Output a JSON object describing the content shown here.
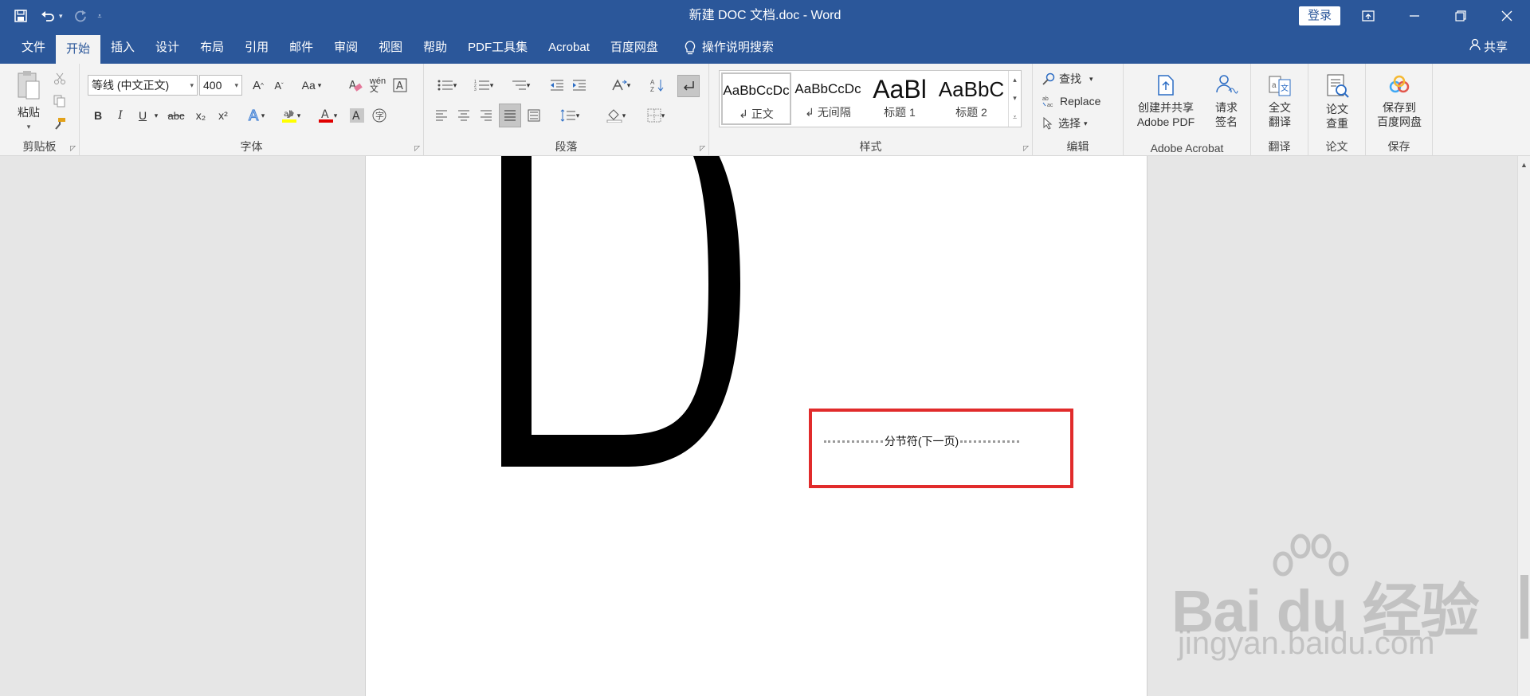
{
  "titlebar": {
    "doc_title": "新建 DOC 文档.doc  -  Word",
    "login_label": "登录",
    "icons": [
      "save-icon",
      "undo-icon",
      "redo-icon",
      "customize-qat-icon"
    ]
  },
  "tabs": {
    "items": [
      "文件",
      "开始",
      "插入",
      "设计",
      "布局",
      "引用",
      "邮件",
      "审阅",
      "视图",
      "帮助",
      "PDF工具集",
      "Acrobat",
      "百度网盘"
    ],
    "active": "开始",
    "search_label": "操作说明搜索",
    "share_label": "共享"
  },
  "ribbon": {
    "clipboard": {
      "paste_label": "粘贴",
      "group_label": "剪贴板"
    },
    "font": {
      "font_name": "等线 (中文正文)",
      "font_size": "400",
      "group_label": "字体",
      "aa_label": "Aa",
      "bold": "B",
      "italic": "I",
      "underline": "U",
      "strike": "abc",
      "sub": "x₂",
      "sup": "x²",
      "a_label": "A"
    },
    "paragraph": {
      "group_label": "段落"
    },
    "styles": {
      "group_label": "样式",
      "items": [
        {
          "preview": "AaBbCcDc",
          "name": "正文"
        },
        {
          "preview": "AaBbCcDc",
          "name": "无间隔"
        },
        {
          "preview": "AaBl",
          "name": "标题 1"
        },
        {
          "preview": "AaBbC",
          "name": "标题 2"
        }
      ]
    },
    "editing": {
      "find_label": "查找",
      "replace_label": "Replace",
      "select_label": "选择",
      "group_label": "编辑"
    },
    "acrobat": {
      "create_label_1": "创建并共享",
      "create_label_2": "Adobe PDF",
      "sign_label_1": "请求",
      "sign_label_2": "签名",
      "group_label": "Adobe Acrobat"
    },
    "translate": {
      "label_1": "全文",
      "label_2": "翻译",
      "group_label": "翻译"
    },
    "paper": {
      "label_1": "论文",
      "label_2": "查重",
      "group_label": "论文"
    },
    "save": {
      "label_1": "保存到",
      "label_2": "百度网盘",
      "group_label": "保存"
    }
  },
  "document": {
    "big_letter": "D",
    "section_break_text": "分节符(下一页)",
    "highlight_color": "#e12b2b"
  },
  "watermark": {
    "brand": "Bai du 经验",
    "url": "jingyan.baidu.com"
  },
  "colors": {
    "title_bar": "#2b579a",
    "ribbon_bg": "#f3f3f3",
    "workspace_bg": "#e6e6e6"
  }
}
